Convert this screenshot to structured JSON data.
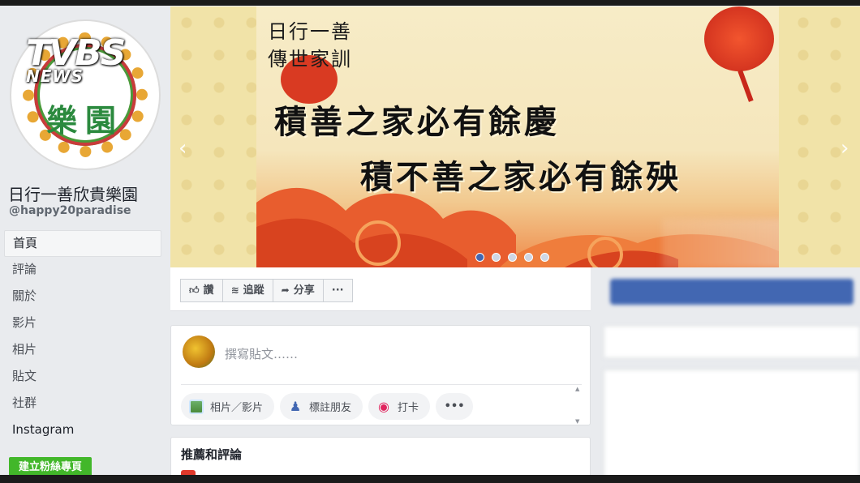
{
  "overlay": {
    "logo_main": "TVBS",
    "logo_sub": "NEWS"
  },
  "profile": {
    "avatar_text": "樂園",
    "page_name": "日行一善欣貴樂園",
    "handle": "@happy20paradise"
  },
  "nav": {
    "items": [
      {
        "label": "首頁",
        "active": true
      },
      {
        "label": "評論"
      },
      {
        "label": "關於"
      },
      {
        "label": "影片"
      },
      {
        "label": "相片"
      },
      {
        "label": "貼文"
      },
      {
        "label": "社群"
      },
      {
        "label": "Instagram"
      }
    ],
    "create_label": "建立粉絲專頁"
  },
  "cover": {
    "small_line1": "日行一善",
    "small_line2": "傳世家訓",
    "big_line1": "積善之家必有餘慶",
    "big_line2": "積不善之家必有餘殃",
    "slide_count": 5,
    "active_slide": 1,
    "accent": "#d93a22"
  },
  "actions": {
    "like": "讚",
    "follow": "追蹤",
    "share": "分享",
    "more": "···"
  },
  "composer": {
    "placeholder": "撰寫貼文……",
    "photo": "相片／影片",
    "tag": "標註朋友",
    "checkin": "打卡",
    "more": "•••"
  },
  "reviews": {
    "title": "推薦和評論"
  },
  "colors": {
    "brand_blue": "#4267b2",
    "create_green": "#42b72a"
  }
}
